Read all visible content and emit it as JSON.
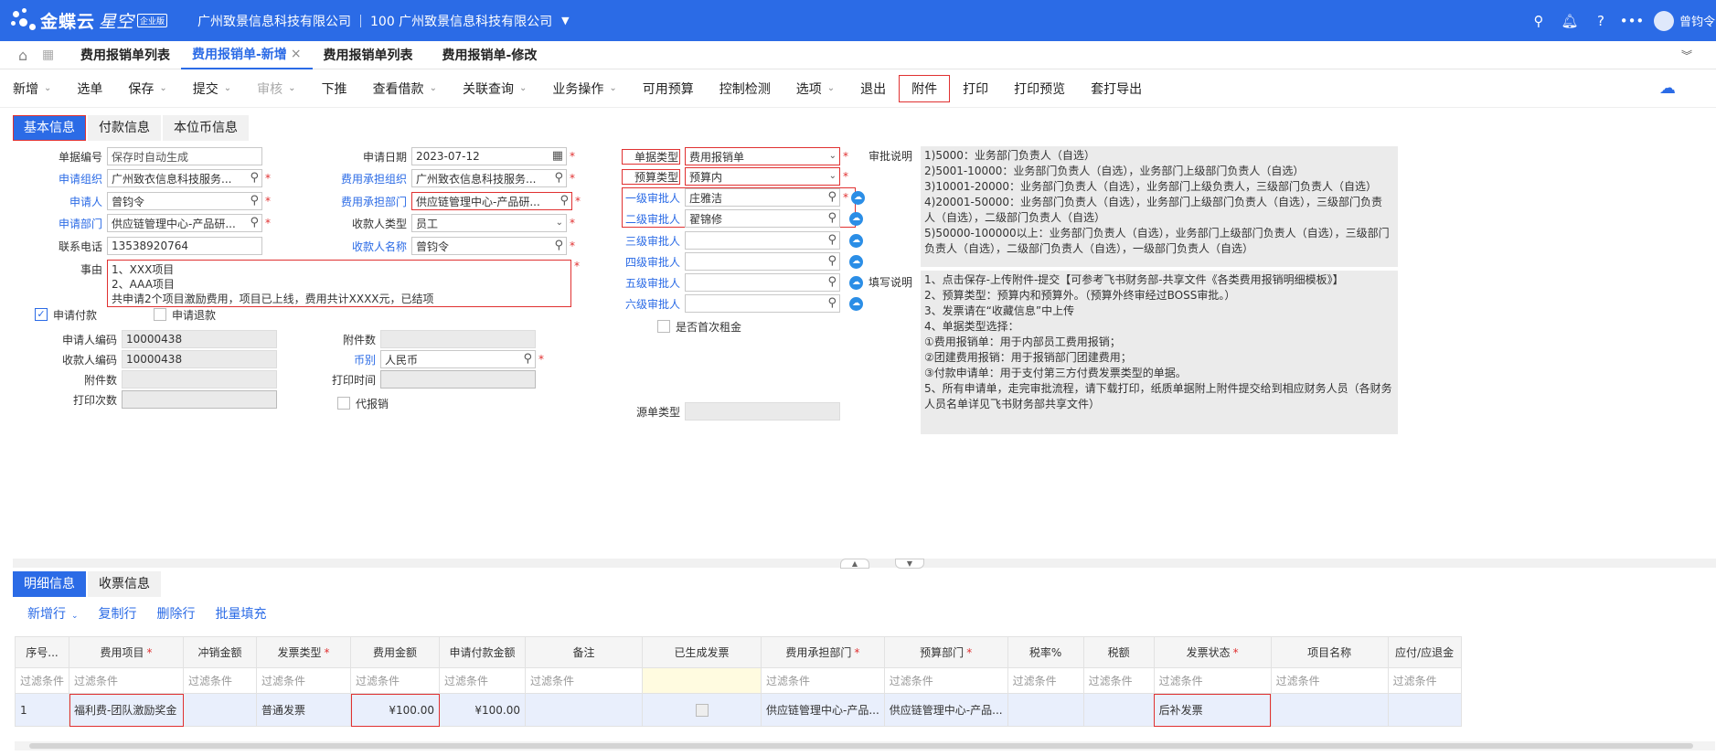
{
  "brand": {
    "name": "金蝶云",
    "name2": "星空",
    "edition": "企业版"
  },
  "org": {
    "company": "广州致景信息科技有限公司",
    "account": "100 广州致景信息科技有限公司"
  },
  "user": {
    "name": "曾钧令"
  },
  "tabs": [
    "费用报销单列表",
    "费用报销单-新增",
    "费用报销单列表",
    "费用报销单-修改"
  ],
  "toolbar": [
    {
      "label": "新增",
      "caret": true
    },
    {
      "label": "选单"
    },
    {
      "label": "保存",
      "caret": true
    },
    {
      "label": "提交",
      "caret": true
    },
    {
      "label": "审核",
      "caret": true,
      "disabled": true
    },
    {
      "label": "下推"
    },
    {
      "label": "查看借款",
      "caret": true
    },
    {
      "label": "关联查询",
      "caret": true
    },
    {
      "label": "业务操作",
      "caret": true
    },
    {
      "label": "可用预算"
    },
    {
      "label": "控制检测"
    },
    {
      "label": "选项",
      "caret": true
    },
    {
      "label": "退出"
    },
    {
      "label": "附件",
      "highlight": true
    },
    {
      "label": "打印"
    },
    {
      "label": "打印预览"
    },
    {
      "label": "套打导出"
    }
  ],
  "subtabs": [
    "基本信息",
    "付款信息",
    "本位币信息"
  ],
  "form": {
    "bill_no": {
      "label": "单据编号",
      "placeholder": "保存时自动生成"
    },
    "apply_org": {
      "label": "申请组织",
      "value": "广州致衣信息科技服务..."
    },
    "applicant": {
      "label": "申请人",
      "value": "曾钧令"
    },
    "apply_dept": {
      "label": "申请部门",
      "value": "供应链管理中心-产品研..."
    },
    "phone": {
      "label": "联系电话",
      "value": "13538920764"
    },
    "reason": {
      "label": "事由",
      "lines": [
        "1、XXX项目",
        "2、AAA项目",
        "共申请2个项目激励费用，项目已上线，费用共计XXXX元，已结项"
      ]
    },
    "apply_date": {
      "label": "申请日期",
      "value": "2023-07-12"
    },
    "cost_org": {
      "label": "费用承担组织",
      "value": "广州致衣信息科技服务..."
    },
    "cost_dept": {
      "label": "费用承担部门",
      "value": "供应链管理中心-产品研..."
    },
    "payee_type": {
      "label": "收款人类型",
      "value": "员工"
    },
    "payee_name": {
      "label": "收款人名称",
      "value": "曾钧令"
    },
    "bill_type": {
      "label": "单据类型",
      "value": "费用报销单"
    },
    "budget_type": {
      "label": "预算类型",
      "value": "预算内"
    },
    "approver1": {
      "label": "一级审批人",
      "value": "庄雅洁"
    },
    "approver2": {
      "label": "二级审批人",
      "value": "翟锦修"
    },
    "approver3": {
      "label": "三级审批人",
      "value": ""
    },
    "approver4": {
      "label": "四级审批人",
      "value": ""
    },
    "approver5": {
      "label": "五级审批人",
      "value": ""
    },
    "approver6": {
      "label": "六级审批人",
      "value": ""
    },
    "first_rent": {
      "label": "是否首次租金"
    },
    "apply_pay": {
      "label": "申请付款"
    },
    "apply_refund": {
      "label": "申请退款"
    },
    "applicant_code": {
      "label": "申请人编码",
      "value": "10000438"
    },
    "payee_code": {
      "label": "收款人编码",
      "value": "10000438"
    },
    "attach_count": {
      "label": "附件数",
      "value": ""
    },
    "print_count": {
      "label": "打印次数",
      "value": ""
    },
    "attach_num": {
      "label": "附件数",
      "value": ""
    },
    "currency": {
      "label": "币别",
      "value": "人民币"
    },
    "print_time": {
      "label": "打印时间",
      "value": ""
    },
    "proxy": {
      "label": "代报销"
    },
    "source_type": {
      "label": "源单类型",
      "value": ""
    }
  },
  "approval_note": {
    "label": "审批说明",
    "lines": [
      "1)5000：业务部门负责人（自选）",
      "2)5001-10000：业务部门负责人（自选），业务部门上级部门负责人（自选）",
      "3)10001-20000：业务部门负责人（自选），业务部门上级负责人，三级部门负责人（自选）",
      "4)20001-50000：业务部门负责人（自选），业务部门上级部门负责人（自选），三级部门负责",
      "人（自选），二级部门负责人（自选）",
      "5)50000-100000以上：业务部门负责人（自选），业务部门上级部门负责人（自选），三级部门",
      "负责人（自选），二级部门负责人（自选），一级部门负责人（自选）"
    ]
  },
  "fill_note": {
    "label": "填写说明",
    "lines": [
      "1、点击保存-上传附件-提交【可参考飞书财务部-共享文件《各类费用报销明细模板》】",
      "2、预算类型：预算内和预算外。（预算外终审经过BOSS审批。）",
      "3、发票请在“收藏信息”中上传",
      "4、单据类型选择：",
      "①费用报销单：用于内部员工费用报销；",
      "②团建费用报销：用于报销部门团建费用；",
      "③付款申请单：用于支付第三方付费发票类型的单据。",
      "5、所有申请单，走完审批流程，请下载打印，纸质单据附上附件提交给到相应财务人员（各财务",
      "人员名单详见飞书财务部共享文件）"
    ]
  },
  "bottom_tabs": [
    "明细信息",
    "收票信息"
  ],
  "detail_actions": [
    "新增行",
    "复制行",
    "删除行",
    "批量填充"
  ],
  "grid": {
    "columns": [
      "序号...",
      "费用项目",
      "冲销金额",
      "发票类型",
      "费用金额",
      "申请付款金额",
      "备注",
      "已生成发票",
      "费用承担部门",
      "预算部门",
      "税率%",
      "税额",
      "发票状态",
      "项目名称",
      "应付/应退金"
    ],
    "filter": "过滤条件",
    "rows": [
      [
        "1",
        "福利费-团队激励奖金",
        "",
        "普通发票",
        "¥100.00",
        "¥100.00",
        "",
        "",
        "供应链管理中心-产品...",
        "供应链管理中心-产品...",
        "",
        "",
        "后补发票",
        "",
        ""
      ]
    ]
  }
}
